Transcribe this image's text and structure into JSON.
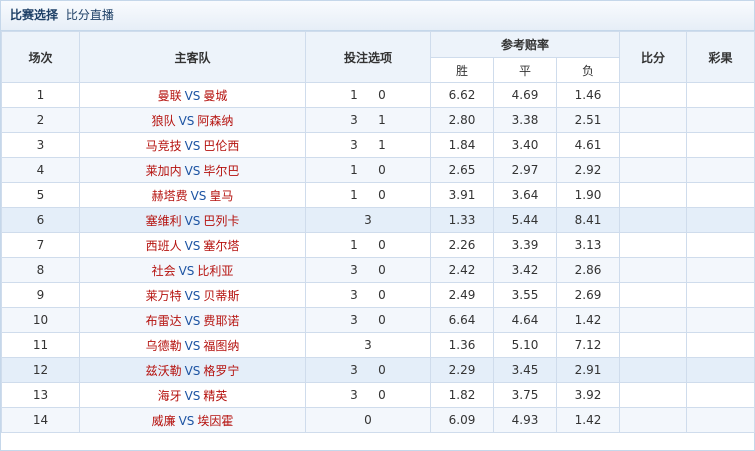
{
  "header": {
    "title": "比赛选择",
    "subtitle": "比分直播"
  },
  "columns": {
    "index": "场次",
    "match": "主客队",
    "options": "投注选项",
    "odds_group": "参考赔率",
    "win": "胜",
    "draw": "平",
    "lose": "负",
    "score": "比分",
    "result": "彩果"
  },
  "vs_label": "VS",
  "rows": [
    {
      "n": "1",
      "home": "曼联",
      "away": "曼城",
      "opts": [
        "1",
        "0"
      ],
      "win": "6.62",
      "draw": "4.69",
      "lose": "1.46"
    },
    {
      "n": "2",
      "home": "狼队",
      "away": "阿森纳",
      "opts": [
        "3",
        "1"
      ],
      "win": "2.80",
      "draw": "3.38",
      "lose": "2.51"
    },
    {
      "n": "3",
      "home": "马竞技",
      "away": "巴伦西",
      "opts": [
        "3",
        "1"
      ],
      "win": "1.84",
      "draw": "3.40",
      "lose": "4.61"
    },
    {
      "n": "4",
      "home": "莱加内",
      "away": "毕尔巴",
      "opts": [
        "1",
        "0"
      ],
      "win": "2.65",
      "draw": "2.97",
      "lose": "2.92"
    },
    {
      "n": "5",
      "home": "赫塔费",
      "away": "皇马",
      "opts": [
        "1",
        "0"
      ],
      "win": "3.91",
      "draw": "3.64",
      "lose": "1.90"
    },
    {
      "n": "6",
      "home": "塞维利",
      "away": "巴列卡",
      "opts": [
        "3"
      ],
      "win": "1.33",
      "draw": "5.44",
      "lose": "8.41"
    },
    {
      "n": "7",
      "home": "西班人",
      "away": "塞尔塔",
      "opts": [
        "1",
        "0"
      ],
      "win": "2.26",
      "draw": "3.39",
      "lose": "3.13"
    },
    {
      "n": "8",
      "home": "社会",
      "away": "比利亚",
      "opts": [
        "3",
        "0"
      ],
      "win": "2.42",
      "draw": "3.42",
      "lose": "2.86"
    },
    {
      "n": "9",
      "home": "莱万特",
      "away": "贝蒂斯",
      "opts": [
        "3",
        "0"
      ],
      "win": "2.49",
      "draw": "3.55",
      "lose": "2.69"
    },
    {
      "n": "10",
      "home": "布雷达",
      "away": "费耶诺",
      "opts": [
        "3",
        "0"
      ],
      "win": "6.64",
      "draw": "4.64",
      "lose": "1.42"
    },
    {
      "n": "11",
      "home": "乌德勒",
      "away": "福图纳",
      "opts": [
        "3"
      ],
      "win": "1.36",
      "draw": "5.10",
      "lose": "7.12"
    },
    {
      "n": "12",
      "home": "兹沃勒",
      "away": "格罗宁",
      "opts": [
        "3",
        "0"
      ],
      "win": "2.29",
      "draw": "3.45",
      "lose": "2.91"
    },
    {
      "n": "13",
      "home": "海牙",
      "away": "精英",
      "opts": [
        "3",
        "0"
      ],
      "win": "1.82",
      "draw": "3.75",
      "lose": "3.92"
    },
    {
      "n": "14",
      "home": "威廉",
      "away": "埃因霍",
      "opts": [
        "0"
      ],
      "win": "6.09",
      "draw": "4.93",
      "lose": "1.42"
    }
  ]
}
